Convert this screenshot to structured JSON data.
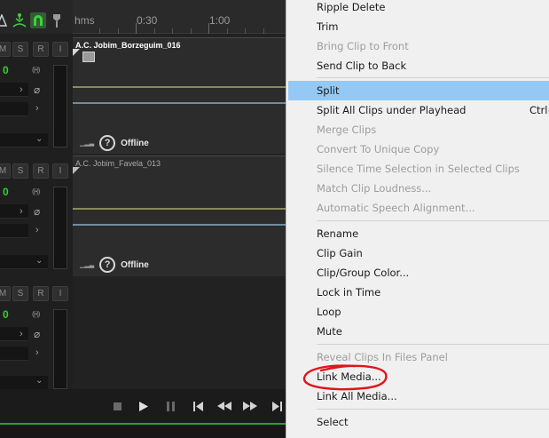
{
  "editor": {
    "top_icons": [
      "shape-icon",
      "snap-icon",
      "magnet-icon",
      "marker-icon"
    ],
    "ruler": {
      "unit": "hms",
      "ticks": [
        "0:30",
        "1:00"
      ]
    },
    "track_buttons": {
      "mute": "M",
      "solo": "S",
      "record": "R",
      "input": "I"
    },
    "volume_value": "0",
    "clips": [
      {
        "name": "A.C. Jobim_Borzeguim_016",
        "status": "Offline"
      },
      {
        "name": "A.C. Jobim_Favela_013",
        "status": "Offline"
      }
    ]
  },
  "transport": [
    "stop-icon",
    "play-icon",
    "pause-icon",
    "skip-back-icon",
    "rewind-icon",
    "fast-forward-icon",
    "skip-forward-icon"
  ],
  "context_menu": {
    "items": [
      {
        "label": "Ripple Delete"
      },
      {
        "label": "Trim"
      },
      {
        "label": "Bring Clip to Front",
        "disabled": true
      },
      {
        "label": "Send Clip to Back"
      },
      {
        "label": "Split",
        "highlighted": true
      },
      {
        "label": "Split All Clips under Playhead",
        "shortcut": "Ctrl+"
      },
      {
        "label": "Merge Clips",
        "disabled": true
      },
      {
        "label": "Convert To Unique Copy",
        "disabled": true
      },
      {
        "label": "Silence Time Selection in Selected Clips",
        "disabled": true
      },
      {
        "label": "Match Clip Loudness...",
        "disabled": true
      },
      {
        "label": "Automatic Speech Alignment...",
        "disabled": true
      },
      {
        "label": "Rename"
      },
      {
        "label": "Clip Gain"
      },
      {
        "label": "Clip/Group Color..."
      },
      {
        "label": "Lock in Time"
      },
      {
        "label": "Loop"
      },
      {
        "label": "Mute"
      },
      {
        "label": "Reveal Clips In Files Panel",
        "disabled": true
      },
      {
        "label": "Link Media...",
        "circled": true
      },
      {
        "label": "Link All Media..."
      },
      {
        "label": "Select"
      }
    ]
  },
  "colors": {
    "menu_background": "#f0f0f0",
    "menu_highlight": "#94c9f5",
    "disabled_text": "#9d9d9d",
    "annotation": "#e0151b",
    "meter_green": "#33d033"
  }
}
